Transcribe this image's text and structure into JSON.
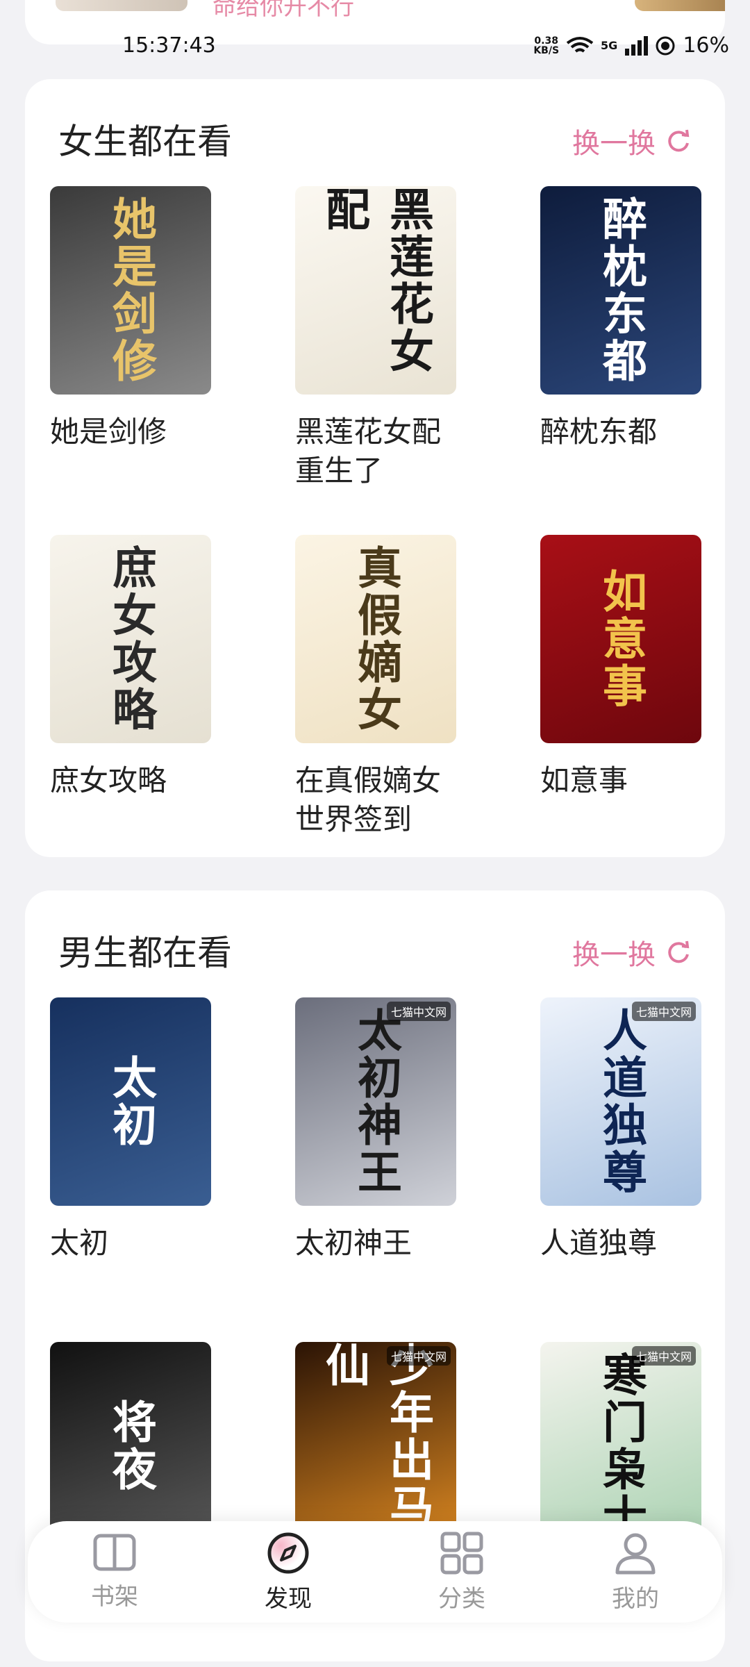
{
  "previous_card": {
    "text": "命给你开不行"
  },
  "status_bar": {
    "time": "15:37:43",
    "net_speed": "0.38",
    "net_unit": "KB/S",
    "battery": "16%",
    "signal_label": "5G"
  },
  "sections": [
    {
      "title": "女生都在看",
      "refresh_label": "换一换",
      "books": [
        {
          "title": "她是剑修",
          "cover_text": "她是剑修",
          "cover_colors": [
            "#3a3a3a",
            "#8a8a8a"
          ],
          "cover_text_color": "#e8c46a"
        },
        {
          "title": "黑莲花女配重生了",
          "cover_text": "黑莲花女配",
          "cover_colors": [
            "#fbf8f1",
            "#e9e3d4"
          ],
          "cover_text_color": "#1a1a1a"
        },
        {
          "title": "醉枕东都",
          "cover_text": "醉枕东都",
          "cover_colors": [
            "#0e1c3c",
            "#2b4679"
          ],
          "cover_text_color": "#ffffff"
        },
        {
          "title": "庶女攻略",
          "cover_text": "庶女攻略",
          "cover_colors": [
            "#f7f4ec",
            "#e5e0d2"
          ],
          "cover_text_color": "#2a2a2a"
        },
        {
          "title": "在真假嫡女世界签到",
          "cover_text": "真假嫡女",
          "cover_colors": [
            "#fbf4e4",
            "#efe1c3"
          ],
          "cover_text_color": "#4a3a1a"
        },
        {
          "title": "如意事",
          "cover_text": "如意事",
          "cover_colors": [
            "#a80f16",
            "#6e070d"
          ],
          "cover_text_color": "#f2c34c"
        }
      ]
    },
    {
      "title": "男生都在看",
      "refresh_label": "换一换",
      "books": [
        {
          "title": "太初",
          "cover_text": "太初",
          "cover_colors": [
            "#16305e",
            "#3a5e92"
          ],
          "cover_text_color": "#ffffff",
          "brand": ""
        },
        {
          "title": "太初神王",
          "cover_text": "太初神王",
          "cover_colors": [
            "#6b6e7c",
            "#cfd1d8"
          ],
          "cover_text_color": "#1b1b1b",
          "brand": "七猫中文网"
        },
        {
          "title": "人道独尊",
          "cover_text": "人道独尊",
          "cover_colors": [
            "#eef3fb",
            "#a9c2e1"
          ],
          "cover_text_color": "#0e2554",
          "brand": "七猫中文网"
        },
        {
          "title": "",
          "cover_text": "将夜",
          "cover_colors": [
            "#111111",
            "#5a5a5a"
          ],
          "cover_text_color": "#ffffff",
          "brand": ""
        },
        {
          "title": "",
          "cover_text": "少年出马仙",
          "cover_colors": [
            "#2a1305",
            "#e08b22"
          ],
          "cover_text_color": "#ffffff",
          "brand": "七猫中文网"
        },
        {
          "title": "",
          "cover_text": "寒门枭士",
          "cover_colors": [
            "#f4f4ee",
            "#a8d1b0"
          ],
          "cover_text_color": "#111111",
          "brand": "七猫中文网"
        }
      ]
    }
  ],
  "bottom_nav": [
    {
      "label": "书架",
      "icon": "book-open-icon",
      "active": false
    },
    {
      "label": "发现",
      "icon": "compass-icon",
      "active": true
    },
    {
      "label": "分类",
      "icon": "grid-icon",
      "active": false
    },
    {
      "label": "我的",
      "icon": "user-icon",
      "active": false
    }
  ]
}
